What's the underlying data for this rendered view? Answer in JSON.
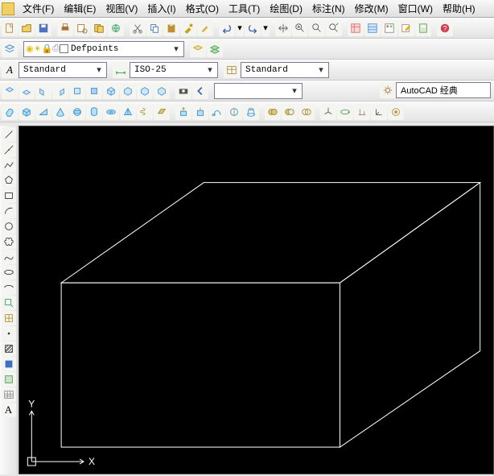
{
  "menu": {
    "file": "文件(F)",
    "edit": "编辑(E)",
    "view": "视图(V)",
    "insert": "插入(I)",
    "format": "格式(O)",
    "tools": "工具(T)",
    "draw": "绘图(D)",
    "annotate": "标注(N)",
    "modify": "修改(M)",
    "window": "窗口(W)",
    "help": "帮助(H)"
  },
  "layer": {
    "current": "Defpoints"
  },
  "textstyle": {
    "current": "Standard"
  },
  "dimstyle": {
    "current": "ISO-25"
  },
  "tablestyle": {
    "current": "Standard"
  },
  "command_input": {
    "value": ""
  },
  "workspace": {
    "current": "AutoCAD 经典"
  },
  "ucs": {
    "x": "X",
    "y": "Y"
  }
}
